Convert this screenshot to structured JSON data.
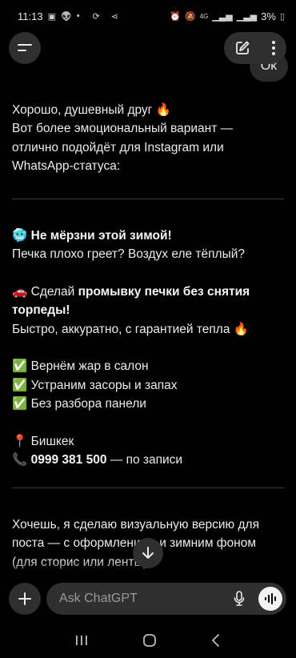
{
  "status_bar": {
    "time": "11:13",
    "network": "4G",
    "battery": "3%"
  },
  "header": {
    "menu_icon": "menu-icon",
    "compose_icon": "edit-icon",
    "more_icon": "more-vertical-icon"
  },
  "user_bubble": {
    "text": "Ok"
  },
  "message": {
    "intro": [
      "Хорошо, душевный друг 🔥",
      "Вот более эмоциональный вариант —",
      "отлично подойдёт для Instagram или",
      "WhatsApp-статуса:"
    ],
    "headline_emoji": "🥶",
    "headline": "Не мёрзни этой зимой!",
    "line2": "Печка плохо греет? Воздух еле тёплый?",
    "offer_emoji": "🚗",
    "offer_prefix": "Сделай",
    "offer_bold_1": "промывку печки без снятия",
    "offer_bold_2": "торпеды!",
    "offer_tail": "Быстро, аккуратно, с гарантией тепла 🔥",
    "checks": [
      "Вернём жар в салон",
      "Устраним засоры и запах",
      "Без разбора панели"
    ],
    "check_emoji": "✅",
    "city_emoji": "📍",
    "city": "Бишкек",
    "phone_emoji": "📞",
    "phone": "0999 381 500",
    "phone_tail": "— по записи",
    "followup_1": "Хочешь, я сделаю визуальную версию для",
    "followup_2": "поста — с оформлением и зимним фоном",
    "followup_3": "(для сторис или ленты)?"
  },
  "composer": {
    "placeholder": "Ask ChatGPT"
  },
  "colors": {
    "background": "#000000",
    "surface": "#2f2f2f",
    "text": "#ececec"
  }
}
